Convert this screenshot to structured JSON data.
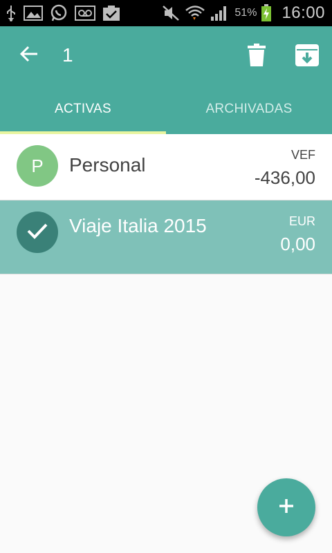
{
  "status_bar": {
    "battery_percent": "51%",
    "time": "16:00",
    "icons": [
      "usb-icon",
      "image-icon",
      "whatsapp-icon",
      "voicemail-icon",
      "clipboard-check-icon",
      "mute-icon",
      "wifi-icon",
      "signal-icon",
      "battery-charging-icon"
    ]
  },
  "toolbar": {
    "selection_count": "1",
    "icons": {
      "back": "arrow-back-icon",
      "delete": "trash-icon",
      "archive": "archive-icon"
    }
  },
  "tabs": [
    {
      "label": "ACTIVAS",
      "active": true
    },
    {
      "label": "ARCHIVADAS",
      "active": false
    }
  ],
  "accounts": [
    {
      "initial": "P",
      "name": "Personal",
      "currency": "VEF",
      "amount": "-436,00",
      "selected": false,
      "avatar_color": "#81c784"
    },
    {
      "initial": "",
      "name": "Viaje Italia 2015",
      "currency": "EUR",
      "amount": "0,00",
      "selected": true,
      "avatar_color": "#3a8178"
    }
  ],
  "fab": {
    "icon": "plus-icon"
  },
  "colors": {
    "primary": "#4aab9d",
    "tab_indicator": "#e8f5a0",
    "selected_row": "#7fc1b8"
  }
}
